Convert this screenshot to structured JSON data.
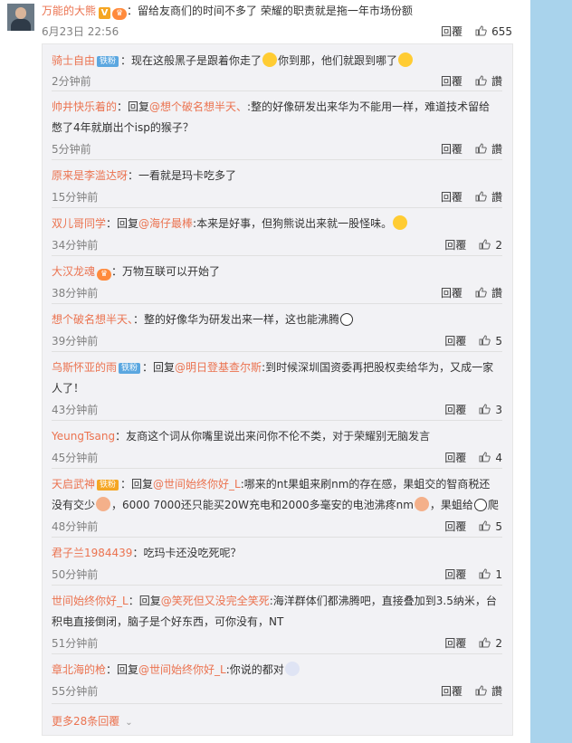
{
  "top_comment": {
    "username": "万能的大熊",
    "badge_v": "V",
    "text": "：留给友商们的时间不多了 荣耀的职责就是拖一年市场份额",
    "time": "6月23日 22:56",
    "reply_label": "回覆",
    "likes": "655"
  },
  "reply_label": "回覆",
  "like_label": "讚",
  "comments": [
    {
      "name": "骑士自由",
      "tag": "铁粉",
      "text": "：现在这般黑子是跟着你走了",
      "text2": "你到那，他们就跟到哪了",
      "time": "2分钟前",
      "likes": "讚"
    },
    {
      "name": "帅井快乐着的",
      "prefix": "：回复",
      "at": "@想个破名想半天、",
      "text": ":整的好像研发出来华为不能用一样，难道技术留给憋了4年就崩出个isp的猴子？",
      "time": "5分钟前",
      "likes": "讚"
    },
    {
      "name": "原来是李滥达呀",
      "text": "：一看就是玛卡吃多了",
      "time": "15分钟前",
      "likes": "讚"
    },
    {
      "name": "双儿哥同学",
      "prefix": "：回复",
      "at": "@海仔最棒",
      "text": ":本来是好事，但狗熊说出来就一股怪味。",
      "time": "34分钟前",
      "likes": "2"
    },
    {
      "name": "大汉龙魂",
      "text": "：万物互联可以开始了",
      "time": "38分钟前",
      "likes": "讚"
    },
    {
      "name": "想个破名想半天、",
      "text": "：整的好像华为研发出来一样，这也能沸腾",
      "time": "39分钟前",
      "likes": "5"
    },
    {
      "name": "乌斯怀亚的雨",
      "tag": "铁粉",
      "prefix": "：回复",
      "at": "@明日登基查尔斯",
      "text": ":到时候深圳国资委再把股权卖给华为，又成一家人了！",
      "time": "43分钟前",
      "likes": "3"
    },
    {
      "name": "YeungTsang",
      "text": "：友商这个词从你嘴里说出来问你不伦不类，对于荣耀别无脑发言",
      "time": "45分钟前",
      "likes": "4"
    },
    {
      "name": "天启武神",
      "tag": "铁粉",
      "prefix": "：回复",
      "at": "@世间始终你好_L",
      "text": ":哪来的nt果蛆来刷nm的存在感，果蛆交的智商税还没有交少",
      "text2": "，6000  7000还只能买20W充电和2000多毫安的电池沸疼nm",
      "text3": "，果蛆给",
      "text4": "爬",
      "time": "48分钟前",
      "likes": "5"
    },
    {
      "name": "君子兰1984439",
      "text": "：吃玛卡还没吃死呢？",
      "time": "50分钟前",
      "likes": "1"
    },
    {
      "name": "世间始终你好_L",
      "prefix": "：回复",
      "at": "@笑死但又没完全笑死",
      "text": ":海洋群体们都沸腾吧，直接叠加到3.5纳米，台积电直接倒闭，脑子是个好东西，可你没有，NT",
      "time": "51分钟前",
      "likes": "2"
    },
    {
      "name": "章北海的枪",
      "prefix": "：回复",
      "at": "@世间始终你好_L",
      "text": ":你说的都对",
      "time": "55分钟前",
      "likes": "讚"
    }
  ],
  "more_replies": "更多28条回覆"
}
